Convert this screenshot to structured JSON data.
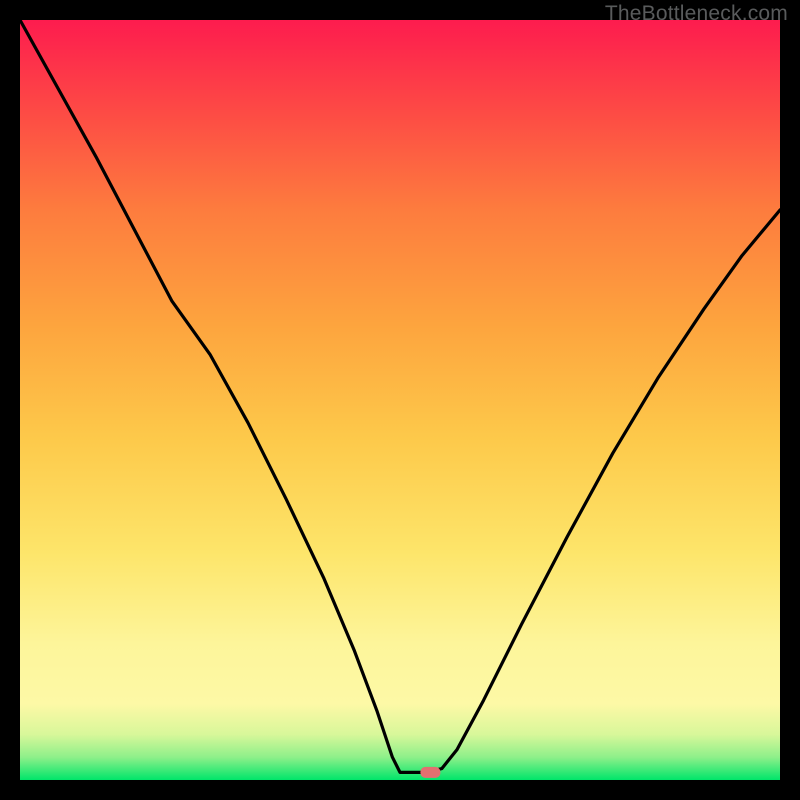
{
  "watermark": "TheBottleneck.com",
  "chart_data": {
    "type": "line",
    "title": "",
    "xlabel": "",
    "ylabel": "",
    "xlim": [
      0,
      1
    ],
    "ylim": [
      0,
      1
    ],
    "gradient_stops": [
      {
        "offset": 0.0,
        "color": "#00e56a"
      },
      {
        "offset": 0.03,
        "color": "#8ef08a"
      },
      {
        "offset": 0.06,
        "color": "#d8f79a"
      },
      {
        "offset": 0.1,
        "color": "#fdf9a6"
      },
      {
        "offset": 0.18,
        "color": "#fdf59a"
      },
      {
        "offset": 0.3,
        "color": "#fde56a"
      },
      {
        "offset": 0.45,
        "color": "#fdc94a"
      },
      {
        "offset": 0.6,
        "color": "#fda43e"
      },
      {
        "offset": 0.75,
        "color": "#fd7c3e"
      },
      {
        "offset": 0.88,
        "color": "#fd4a45"
      },
      {
        "offset": 1.0,
        "color": "#fd1c4e"
      }
    ],
    "series": [
      {
        "name": "bottleneck-curve",
        "points": [
          {
            "x": 0.0,
            "y": 1.0
          },
          {
            "x": 0.05,
            "y": 0.91
          },
          {
            "x": 0.1,
            "y": 0.82
          },
          {
            "x": 0.15,
            "y": 0.725
          },
          {
            "x": 0.2,
            "y": 0.63
          },
          {
            "x": 0.25,
            "y": 0.56
          },
          {
            "x": 0.3,
            "y": 0.47
          },
          {
            "x": 0.35,
            "y": 0.37
          },
          {
            "x": 0.4,
            "y": 0.265
          },
          {
            "x": 0.44,
            "y": 0.17
          },
          {
            "x": 0.47,
            "y": 0.09
          },
          {
            "x": 0.49,
            "y": 0.03
          },
          {
            "x": 0.5,
            "y": 0.01
          },
          {
            "x": 0.515,
            "y": 0.01
          },
          {
            "x": 0.535,
            "y": 0.01
          },
          {
            "x": 0.555,
            "y": 0.015
          },
          {
            "x": 0.575,
            "y": 0.04
          },
          {
            "x": 0.61,
            "y": 0.105
          },
          {
            "x": 0.66,
            "y": 0.205
          },
          {
            "x": 0.72,
            "y": 0.32
          },
          {
            "x": 0.78,
            "y": 0.43
          },
          {
            "x": 0.84,
            "y": 0.53
          },
          {
            "x": 0.9,
            "y": 0.62
          },
          {
            "x": 0.95,
            "y": 0.69
          },
          {
            "x": 1.0,
            "y": 0.75
          }
        ]
      }
    ],
    "marker": {
      "x": 0.54,
      "y": 0.01,
      "color": "#e27070"
    }
  }
}
